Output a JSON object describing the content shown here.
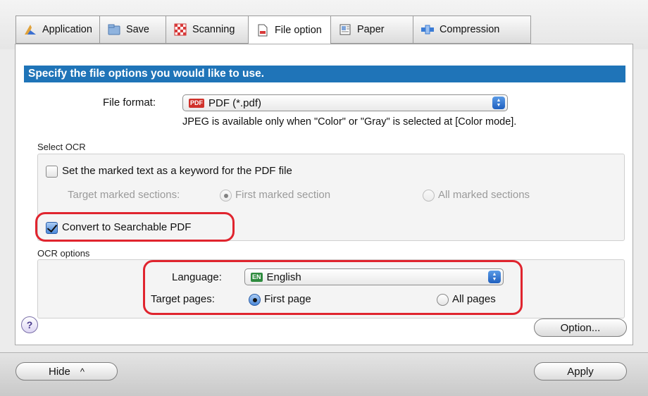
{
  "tabs": [
    {
      "label": "Application",
      "icon": "application-icon"
    },
    {
      "label": "Save",
      "icon": "save-icon"
    },
    {
      "label": "Scanning",
      "icon": "scanning-icon"
    },
    {
      "label": "File option",
      "icon": "file-option-icon"
    },
    {
      "label": "Paper",
      "icon": "paper-icon"
    },
    {
      "label": "Compression",
      "icon": "compression-icon"
    }
  ],
  "active_tab": "File option",
  "header": {
    "title": "Specify the file options you would like to use."
  },
  "file_format": {
    "label": "File format:",
    "badge": "PDF",
    "value": "PDF (*.pdf)",
    "note": "JPEG is available only when \"Color\" or \"Gray\" is selected at [Color mode]."
  },
  "select_ocr": {
    "title": "Select OCR",
    "keyword_label": "Set the marked text as a keyword for the PDF file",
    "keyword_checked": false,
    "target_label": "Target marked sections:",
    "option_first": "First marked section",
    "option_all": "All marked sections",
    "convert_label": "Convert to Searchable PDF",
    "convert_checked": true
  },
  "ocr_options": {
    "title": "OCR options",
    "language_label": "Language:",
    "language_badge": "EN",
    "language_value": "English",
    "target_pages_label": "Target pages:",
    "page_first": "First page",
    "page_all": "All pages",
    "selected": "First page"
  },
  "help": {
    "label": "?"
  },
  "buttons": {
    "option": "Option...",
    "hide": "Hide",
    "hide_arrow": "^",
    "apply": "Apply"
  },
  "colors": {
    "accent": "#1f74b8",
    "highlight": "#e0242e"
  }
}
